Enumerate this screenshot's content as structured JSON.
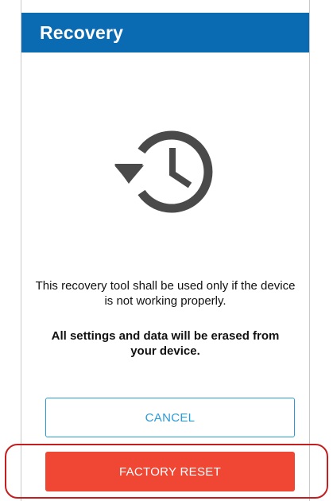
{
  "app_bar": {
    "title": "Recovery",
    "color": "#0a6ab2"
  },
  "illustration": {
    "icon": "restore-history-icon"
  },
  "message": {
    "text": "This recovery tool shall be used only if the device is not working properly.",
    "warning": "All settings and data will be erased from your device."
  },
  "actions": {
    "cancel_label": "CANCEL",
    "reset_label": "FACTORY RESET",
    "cancel_color": "#2a9ad8",
    "reset_color": "#f04634"
  },
  "annotation": {
    "highlight_color": "#c41e1e"
  }
}
